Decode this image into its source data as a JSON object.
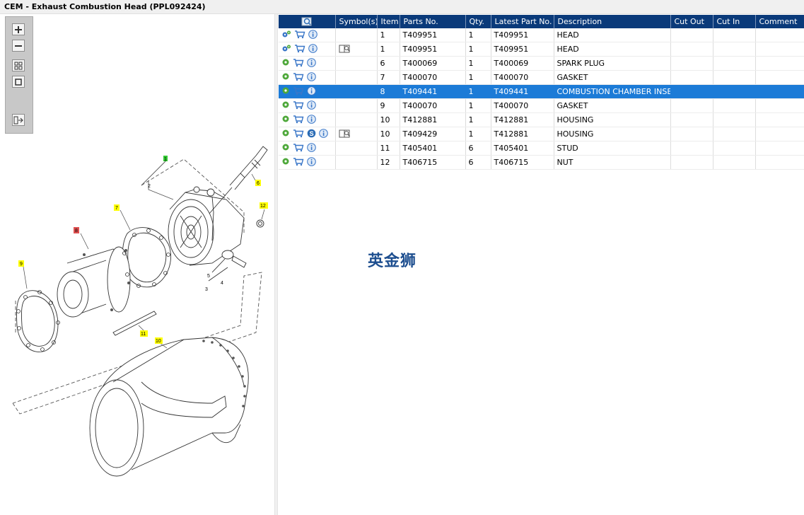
{
  "window": {
    "title": "CEM - Exhaust Combustion Head (PPL092424)"
  },
  "watermark": "英金狮",
  "toolbox": {
    "buttons": [
      "zoom-in",
      "zoom-out",
      "fit-all",
      "actual-size",
      "export"
    ]
  },
  "diagram_callouts": [
    {
      "label": "1",
      "color": "#33cc33"
    },
    {
      "label": "2",
      "color": "none"
    },
    {
      "label": "3",
      "color": "none"
    },
    {
      "label": "4",
      "color": "none"
    },
    {
      "label": "5",
      "color": "none"
    },
    {
      "label": "6",
      "color": "#ffff00"
    },
    {
      "label": "7",
      "color": "#ffff00"
    },
    {
      "label": "8",
      "color": "#e05050"
    },
    {
      "label": "9",
      "color": "#ffff00"
    },
    {
      "label": "10",
      "color": "#ffff00"
    },
    {
      "label": "11",
      "color": "#ffff00"
    },
    {
      "label": "12",
      "color": "#ffff00"
    }
  ],
  "grid": {
    "columns": [
      "",
      "Symbol(s)",
      "Item",
      "Parts No.",
      "Qty.",
      "Latest Part No.",
      "Description",
      "Cut Out",
      "Cut In",
      "Comment"
    ],
    "rows": [
      {
        "icons": [
          "gears-icon",
          "cart-icon",
          "info-icon"
        ],
        "symbol": "book-icon",
        "item": "1",
        "part": "T409951",
        "qty": "1",
        "latest": "T409951",
        "desc": "HEAD",
        "cut_out": "",
        "cut_in": "",
        "comment": "",
        "selected": false,
        "has_symbol": false
      },
      {
        "icons": [
          "gears-icon",
          "cart-icon",
          "info-icon"
        ],
        "symbol": "book-icon",
        "item": "1",
        "part": "T409951",
        "qty": "1",
        "latest": "T409951",
        "desc": "HEAD",
        "cut_out": "",
        "cut_in": "",
        "comment": "",
        "selected": false,
        "has_symbol": true
      },
      {
        "icons": [
          "gear-icon",
          "cart-icon",
          "info-icon"
        ],
        "symbol": "",
        "item": "6",
        "part": "T400069",
        "qty": "1",
        "latest": "T400069",
        "desc": "SPARK PLUG",
        "cut_out": "",
        "cut_in": "",
        "comment": "",
        "selected": false,
        "has_symbol": false
      },
      {
        "icons": [
          "gear-icon",
          "cart-icon",
          "info-icon"
        ],
        "symbol": "",
        "item": "7",
        "part": "T400070",
        "qty": "1",
        "latest": "T400070",
        "desc": "GASKET",
        "cut_out": "",
        "cut_in": "",
        "comment": "",
        "selected": false,
        "has_symbol": false
      },
      {
        "icons": [
          "gear-icon",
          "cart-icon",
          "info-icon"
        ],
        "symbol": "",
        "item": "8",
        "part": "T409441",
        "qty": "1",
        "latest": "T409441",
        "desc": "COMBUSTION CHAMBER INSERT",
        "cut_out": "",
        "cut_in": "",
        "comment": "",
        "selected": true,
        "has_symbol": false
      },
      {
        "icons": [
          "gear-icon",
          "cart-icon",
          "info-icon"
        ],
        "symbol": "",
        "item": "9",
        "part": "T400070",
        "qty": "1",
        "latest": "T400070",
        "desc": "GASKET",
        "cut_out": "",
        "cut_in": "",
        "comment": "",
        "selected": false,
        "has_symbol": false
      },
      {
        "icons": [
          "gear-icon",
          "cart-icon",
          "info-icon"
        ],
        "symbol": "",
        "item": "10",
        "part": "T412881",
        "qty": "1",
        "latest": "T412881",
        "desc": "HOUSING",
        "cut_out": "",
        "cut_in": "",
        "comment": "",
        "selected": false,
        "has_symbol": false
      },
      {
        "icons": [
          "gear-icon",
          "cart-icon",
          "s-icon",
          "info-icon"
        ],
        "symbol": "book-icon",
        "item": "10",
        "part": "T409429",
        "qty": "1",
        "latest": "T412881",
        "desc": "HOUSING",
        "cut_out": "",
        "cut_in": "",
        "comment": "",
        "selected": false,
        "has_symbol": true
      },
      {
        "icons": [
          "gear-icon",
          "cart-icon",
          "info-icon"
        ],
        "symbol": "",
        "item": "11",
        "part": "T405401",
        "qty": "6",
        "latest": "T405401",
        "desc": "STUD",
        "cut_out": "",
        "cut_in": "",
        "comment": "",
        "selected": false,
        "has_symbol": false
      },
      {
        "icons": [
          "gear-icon",
          "cart-icon",
          "info-icon"
        ],
        "symbol": "",
        "item": "12",
        "part": "T406715",
        "qty": "6",
        "latest": "T406715",
        "desc": "NUT",
        "cut_out": "",
        "cut_in": "",
        "comment": "",
        "selected": false,
        "has_symbol": false
      }
    ]
  }
}
